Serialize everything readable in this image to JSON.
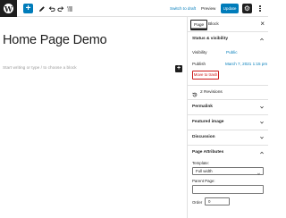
{
  "toolbar": {
    "logo_letter": "W",
    "add_icon": "plus-icon",
    "edit_icon": "pencil-icon",
    "undo_icon": "undo-icon",
    "redo_icon": "redo-icon",
    "outline_icon": "list-view-icon",
    "switch_to_draft": "Switch to draft",
    "preview": "Preview",
    "update": "Update",
    "settings_icon": "gear-icon",
    "more_icon": "more-vertical-icon"
  },
  "editor": {
    "title": "Home Page Demo",
    "block_placeholder": "Start writing or type / to choose a block",
    "inserter_icon": "plus-icon"
  },
  "sidebar": {
    "tabs": {
      "page": "Page",
      "block": "Block"
    },
    "close_icon": "close-icon",
    "status_visibility": {
      "heading": "Status & visibility",
      "visibility_label": "Visibility",
      "visibility_value": "Public",
      "publish_label": "Publish",
      "publish_value": "March 7, 2021 1:15 pm",
      "trash_label": "Move to trash"
    },
    "revisions": "2 Revisions",
    "panels": {
      "permalink": "Permalink",
      "featured_image": "Featured image",
      "discussion": "Discussion"
    },
    "page_attributes": {
      "heading": "Page Attributes",
      "template_label": "Template:",
      "template_value": "Full width",
      "parent_label": "Parent Page:",
      "parent_value": "",
      "order_label": "Order",
      "order_value": "0"
    }
  },
  "colors": {
    "accent": "#007cba",
    "dark": "#1e1e1e",
    "danger": "#cc1818",
    "border": "#e0e0e0"
  }
}
